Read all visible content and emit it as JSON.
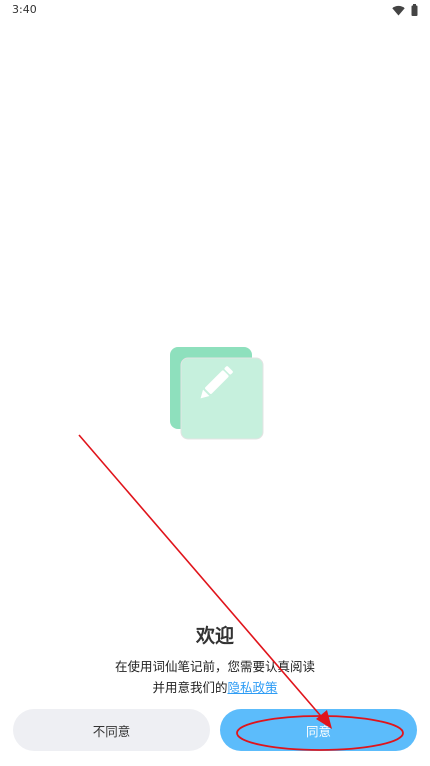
{
  "status_bar": {
    "time": "3:40",
    "icons": [
      "wifi-icon",
      "battery-icon"
    ]
  },
  "logo": {
    "icon": "pencil-note-icon",
    "colors": {
      "back_card": "#8ee0bd",
      "front_card": "#c6f0dd",
      "pencil": "#ffffff"
    }
  },
  "welcome": {
    "title": "欢迎",
    "line1": "在使用词仙笔记前，您需要认真阅读",
    "line2_prefix": "并用意我们的",
    "policy_link": "隐私政策"
  },
  "buttons": {
    "disagree_label": "不同意",
    "agree_label": "同意"
  },
  "colors": {
    "accent": "#5cbcfb",
    "link": "#2f9df5",
    "secondary_button": "#eeeff3",
    "annotation": "#e0141b"
  }
}
